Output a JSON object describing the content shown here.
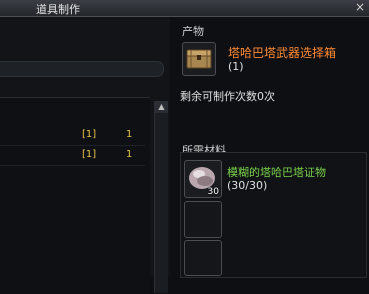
{
  "window": {
    "title": "道具制作",
    "close_glyph": "×"
  },
  "left": {
    "rows": [
      {
        "tag": "[1]",
        "count": "1"
      },
      {
        "tag": "[1]",
        "count": "1"
      }
    ],
    "scroll_up": "▲"
  },
  "product": {
    "section_label": "产物",
    "name": "塔哈巴塔武器选择箱",
    "quantity": "(1)",
    "remaining": "剩余可制作次数0次"
  },
  "materials": {
    "section_label": "所需材料",
    "items": [
      {
        "name": "模糊的塔哈巴塔证物",
        "quantity": "(30/30)",
        "icon_count": "30"
      }
    ]
  },
  "colors": {
    "product_name": "#ff8a33",
    "material_name": "#7ad24a",
    "count_yellow": "#e8c34b"
  }
}
